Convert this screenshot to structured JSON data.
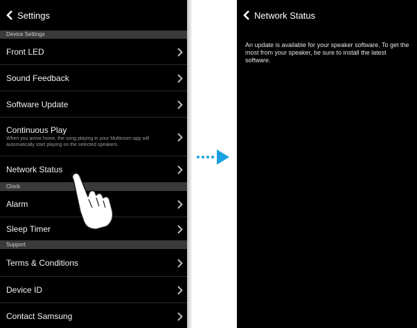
{
  "colors": {
    "accent": "#1aa0e0",
    "screen_bg": "#000000",
    "section_bg": "#3a3a3a"
  },
  "left": {
    "title": "Settings",
    "sections": {
      "device": "Device Settings",
      "clock": "Clock",
      "support": "Support"
    },
    "rows": {
      "front_led": "Front LED",
      "sound_feedback": "Sound Feedback",
      "software_update": "Software Update",
      "continuous_play": "Continuous Play",
      "continuous_play_desc": "When you arrive home, the song playing in your Multiroom app will automatically start playing on the selected speakers.",
      "network_status": "Network Status",
      "alarm": "Alarm",
      "sleep_timer": "Sleep Timer",
      "terms": "Terms & Conditions",
      "device_id": "Device ID",
      "contact": "Contact Samsung"
    }
  },
  "right": {
    "title": "Network Status",
    "message": "An update is available for your speaker software. To get the most from your speaker, be sure to install the latest software."
  },
  "icons": {
    "back": "back-chevron-icon",
    "row_chevron": "chevron-right-icon",
    "arrow": "arrow-right-icon",
    "hand": "tap-hand-icon"
  }
}
